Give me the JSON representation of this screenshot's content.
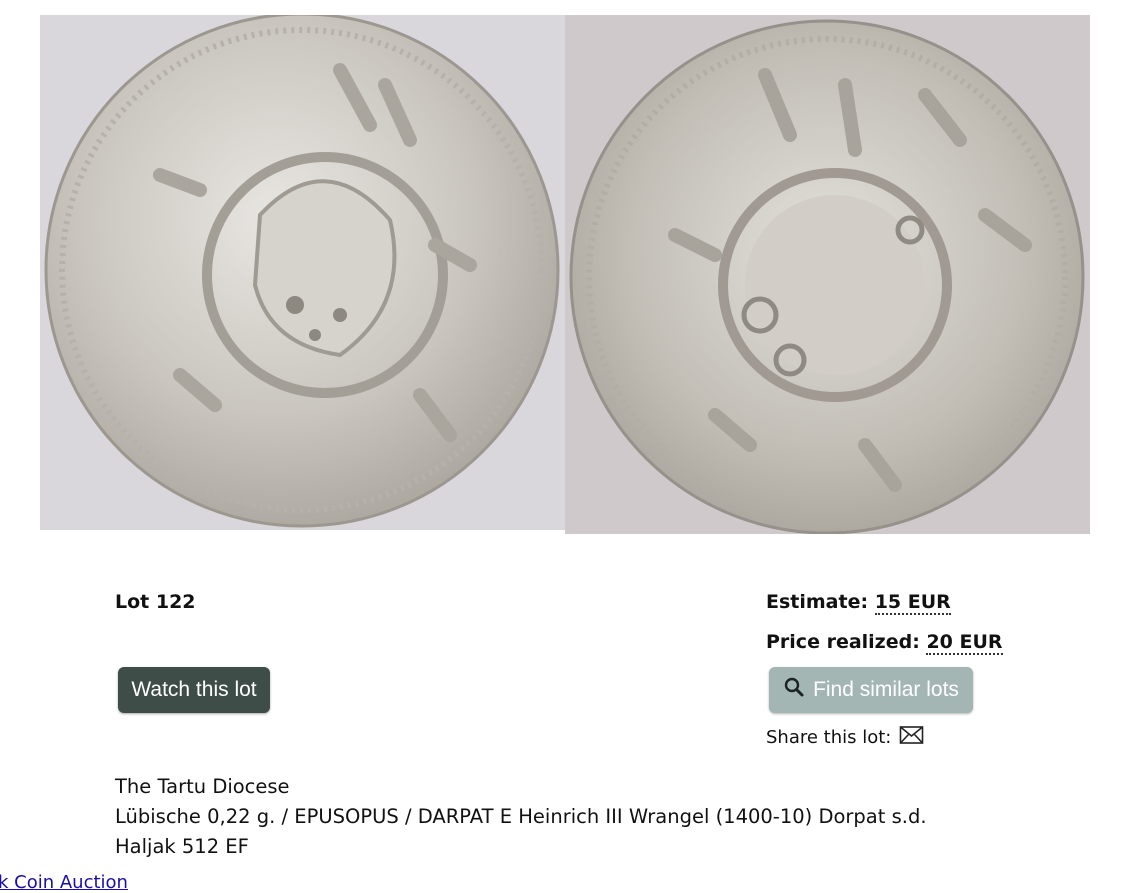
{
  "lot": {
    "title": "Lot 122",
    "estimate_label": "Estimate:",
    "estimate_value": "15 EUR",
    "price_label": "Price realized:",
    "price_value": "20 EUR",
    "watch_label": "Watch this lot",
    "find_similar_label": "Find similar lots",
    "share_label": "Share this lot:"
  },
  "description": {
    "line1": "The Tartu Diocese",
    "line2": "Lübische 0,22 g. / EPUSOPUS / DARPAT E Heinrich III Wrangel (1400-10) Dorpat s.d.",
    "line3": "Haljak 512 EF"
  },
  "footer": {
    "link_text": "ijk Coin Auction"
  },
  "icons": {
    "search": "search-icon",
    "share": "envelope-icon"
  },
  "colors": {
    "watch_button": "#3f4d48",
    "find_similar_button": "#a3b6b4"
  }
}
